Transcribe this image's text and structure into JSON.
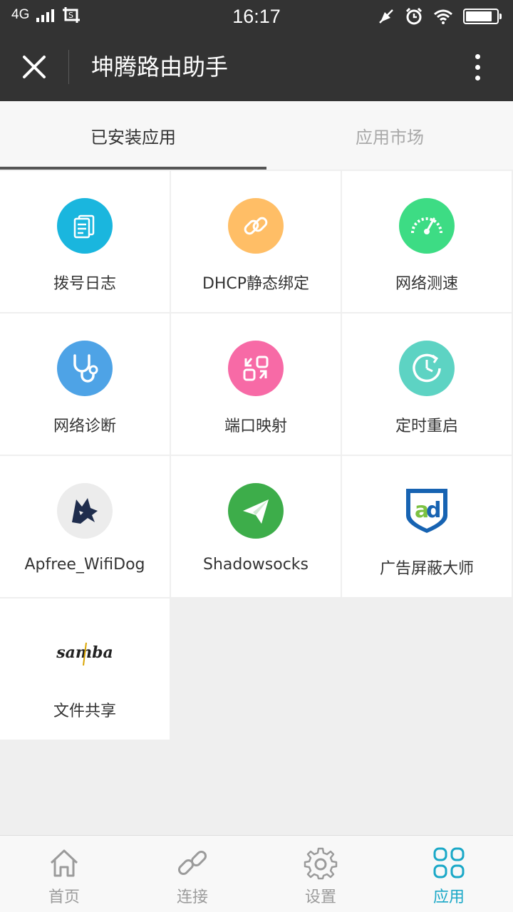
{
  "status_bar": {
    "network": "4G",
    "time": "16:17"
  },
  "app_bar": {
    "title": "坤腾路由助手"
  },
  "tabs": [
    {
      "label": "已安装应用",
      "active": true
    },
    {
      "label": "应用市场",
      "active": false
    }
  ],
  "apps": [
    {
      "label": "拨号日志",
      "icon": "document-icon",
      "color": "#1ab6de"
    },
    {
      "label": "DHCP静态绑定",
      "icon": "link-icon",
      "color": "#ffbe66"
    },
    {
      "label": "网络测速",
      "icon": "speedometer-icon",
      "color": "#3ddc84"
    },
    {
      "label": "网络诊断",
      "icon": "stethoscope-icon",
      "color": "#4ea3e6"
    },
    {
      "label": "端口映射",
      "icon": "port-mapping-icon",
      "color": "#f76aa6"
    },
    {
      "label": "定时重启",
      "icon": "clock-restart-icon",
      "color": "#5dd3c3"
    },
    {
      "label": "Apfree_WifiDog",
      "icon": "wolf-icon",
      "color": "#ececec"
    },
    {
      "label": "Shadowsocks",
      "icon": "paper-plane-icon",
      "color": "#3dad4a"
    },
    {
      "label": "广告屏蔽大师",
      "icon": "ad-shield-icon",
      "color": "#1763b2"
    },
    {
      "label": "文件共享",
      "icon": "samba-icon",
      "color": "#333333",
      "logo_text": "samba"
    }
  ],
  "bottom_nav": [
    {
      "label": "首页",
      "icon": "home-icon",
      "active": false
    },
    {
      "label": "连接",
      "icon": "link-icon",
      "active": false
    },
    {
      "label": "设置",
      "icon": "gear-icon",
      "active": false
    },
    {
      "label": "应用",
      "icon": "apps-grid-icon",
      "active": true
    }
  ],
  "colors": {
    "header_bg": "#333333",
    "accent": "#1aa8c7",
    "inactive_nav": "#9b9b9b"
  }
}
